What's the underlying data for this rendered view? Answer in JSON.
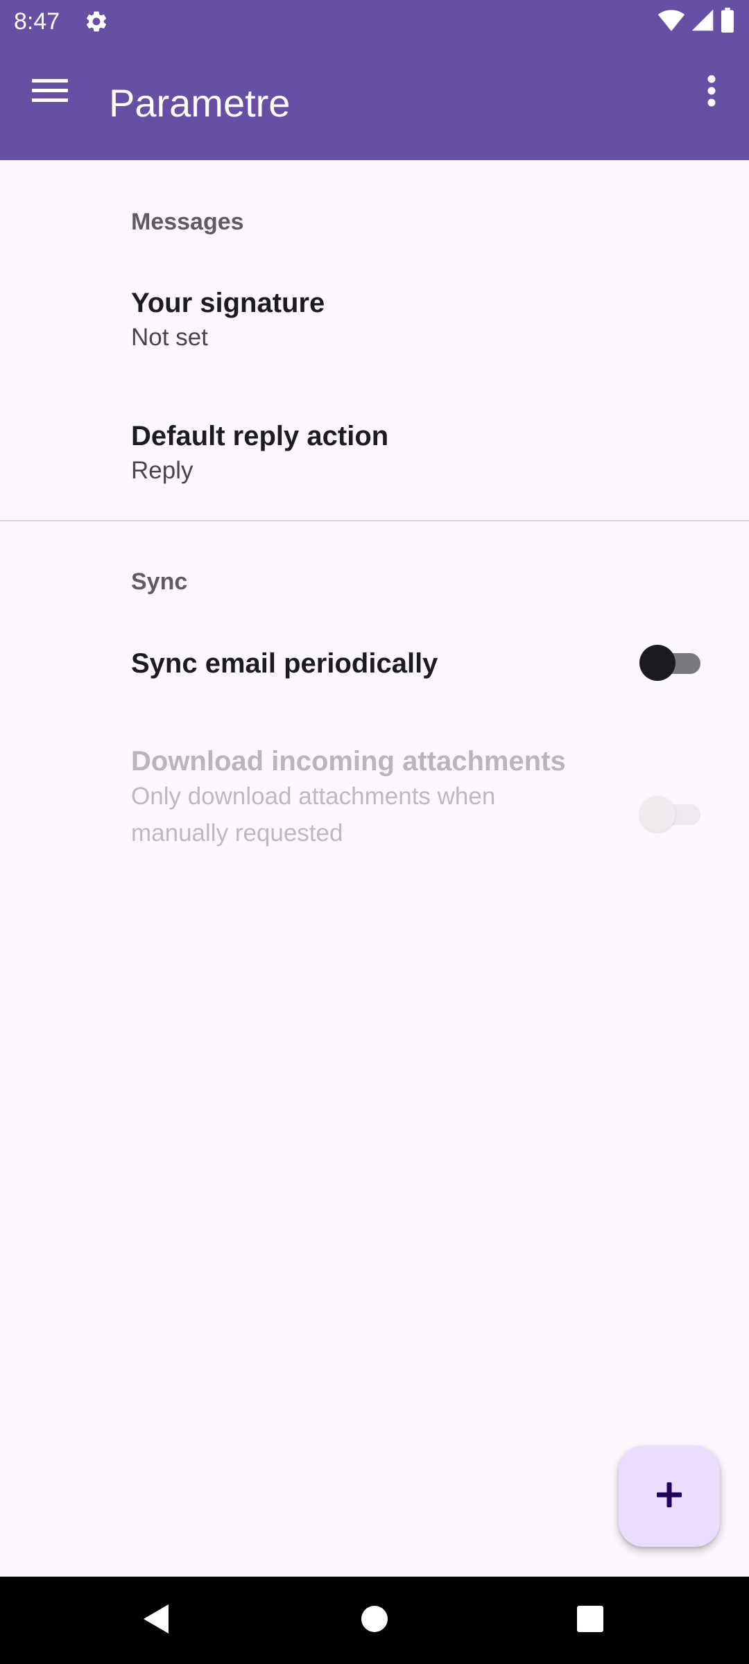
{
  "status_bar": {
    "time": "8:47",
    "icons": [
      "settings-gear-icon",
      "wifi-icon",
      "cellular-signal-icon",
      "battery-icon"
    ]
  },
  "app_bar": {
    "title": "Parametre",
    "navigation_icon": "hamburger-menu-icon",
    "action_icon": "overflow-menu-icon"
  },
  "sections": {
    "messages": {
      "header": "Messages",
      "signature": {
        "title": "Your signature",
        "summary": "Not set"
      },
      "reply_action": {
        "title": "Default reply action",
        "summary": "Reply"
      }
    },
    "sync": {
      "header": "Sync",
      "sync_periodically": {
        "title": "Sync email periodically",
        "checked": false,
        "enabled": true
      },
      "download_attachments": {
        "title": "Download incoming attachments",
        "summary": "Only download attachments when manually requested",
        "checked": false,
        "enabled": false
      }
    }
  },
  "fab": {
    "icon": "plus-icon"
  },
  "nav_bar": {
    "icons": [
      "back-icon",
      "home-icon",
      "recents-icon"
    ]
  },
  "colors": {
    "primary": "#6750A4",
    "background": "#FCF6FD",
    "fab_background": "#EADDFF",
    "fab_icon": "#21005D"
  }
}
